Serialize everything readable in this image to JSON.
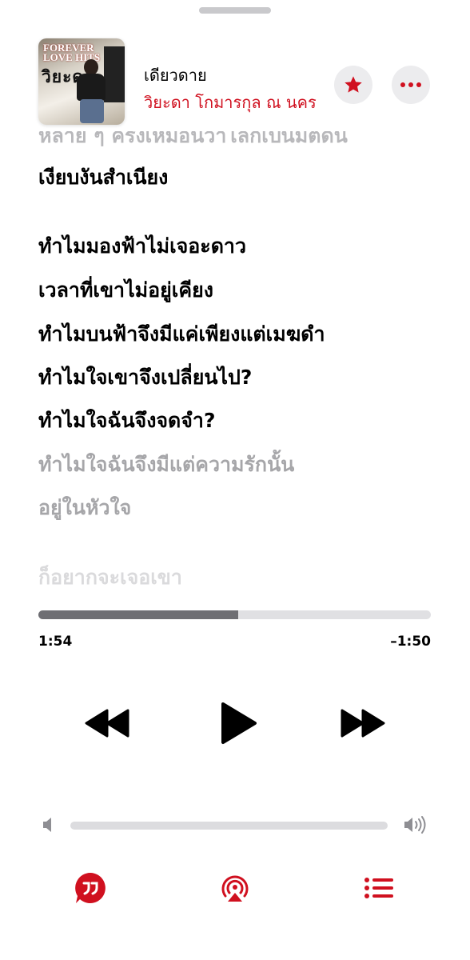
{
  "header": {
    "song_title": "เดียวดาย",
    "artist": "วิยะดา โกมารกุล ณ นคร",
    "album_art": {
      "text_top": "FOREVER\nLOVE HITS",
      "text_name": "วิยะดา"
    }
  },
  "lyrics": {
    "lines": [
      "หลาย ๆ ครั้งเหมือนว่าโลกเป็นมิตดิน",
      "เงียบงันสำเนียง",
      "ทำไมมองฟ้าไม่เจอะดาว",
      "เวลาที่เขาไม่อยู่เคียง",
      "ทำไมบนฟ้าจึงมีแค่เพียงแต่เมฆดำ",
      "ทำไมใจเขาจึงเปลี่ยนไป?",
      "ทำไมใจฉันจึงจดจำ?",
      "ทำไมใจฉันจึงมีแต่ความรักนั้น",
      "อยู่ในหัวใจ",
      "ก็อยากจะเจอเขา"
    ]
  },
  "playback": {
    "elapsed": "1:54",
    "remaining": "–1:50",
    "progress_fraction": 0.51
  },
  "colors": {
    "accent": "#d0101f",
    "lyric_active": "#000000",
    "lyric_dim": "#a6a6a9"
  },
  "icons": {
    "favorite": "star-icon",
    "more": "ellipsis-icon",
    "rewind": "rewind-icon",
    "play": "play-icon",
    "forward": "fast-forward-icon",
    "volume_low": "speaker-low-icon",
    "volume_high": "speaker-high-icon",
    "lyrics": "quote-bubble-icon",
    "airplay": "airplay-icon",
    "queue": "list-icon"
  }
}
